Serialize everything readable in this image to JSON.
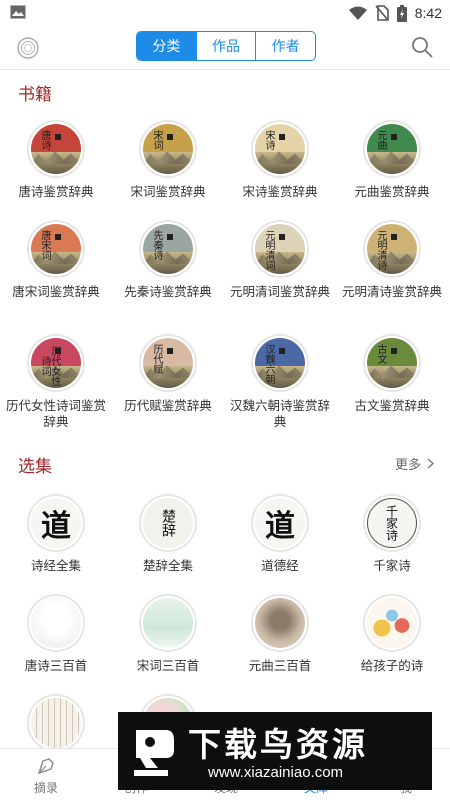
{
  "status_bar": {
    "time": "8:42"
  },
  "nav": {
    "segments": [
      "分类",
      "作品",
      "作者"
    ],
    "active_segment": "分类"
  },
  "books": {
    "title": "书籍",
    "items": [
      {
        "label": "唐诗鉴赏辞典",
        "cover_text": "唐诗",
        "color": "#c6453a"
      },
      {
        "label": "宋词鉴赏辞典",
        "cover_text": "宋词",
        "color": "#c7a04a"
      },
      {
        "label": "宋诗鉴赏辞典",
        "cover_text": "宋诗",
        "color": "#e3d3a6"
      },
      {
        "label": "元曲鉴赏辞典",
        "cover_text": "元曲",
        "color": "#3f8a4c"
      },
      {
        "label": "唐宋词鉴赏辞典",
        "cover_text": "唐宋词",
        "color": "#d97a55"
      },
      {
        "label": "先秦诗鉴赏辞典",
        "cover_text": "先秦诗",
        "color": "#9aa6a2"
      },
      {
        "label": "元明清词鉴赏辞典",
        "cover_text": "元明清词",
        "color": "#ddd3b9"
      },
      {
        "label": "元明清诗鉴赏辞典",
        "cover_text": "元明清诗",
        "color": "#cdb274"
      },
      {
        "label": "历代女性诗词鉴赏辞典",
        "cover_text": "历代女性诗词",
        "color": "#c9485f"
      },
      {
        "label": "历代赋鉴赏辞典",
        "cover_text": "历代赋",
        "color": "#d7b9a4"
      },
      {
        "label": "汉魏六朝诗鉴赏辞典",
        "cover_text": "汉魏六朝",
        "color": "#4c68a5"
      },
      {
        "label": "古文鉴赏辞典",
        "cover_text": "古文",
        "color": "#6a8a3c"
      }
    ]
  },
  "collections": {
    "title": "选集",
    "more_label": "更多",
    "items": [
      {
        "label": "诗经全集",
        "glyph": "道"
      },
      {
        "label": "楚辞全集",
        "glyph": "楚辞"
      },
      {
        "label": "道德经",
        "glyph": "道"
      },
      {
        "label": "千家诗",
        "glyph": "千家诗"
      },
      {
        "label": "唐诗三百首",
        "glyph": ""
      },
      {
        "label": "宋词三百首",
        "glyph": ""
      },
      {
        "label": "元曲三百首",
        "glyph": ""
      },
      {
        "label": "给孩子的诗",
        "glyph": ""
      }
    ]
  },
  "tabbar": {
    "items": [
      "摘录",
      "创作",
      "发现",
      "文库",
      "我"
    ],
    "active": "文库"
  },
  "watermark": {
    "title": "下载鸟资源",
    "url": "www.xiazainiao.com"
  }
}
